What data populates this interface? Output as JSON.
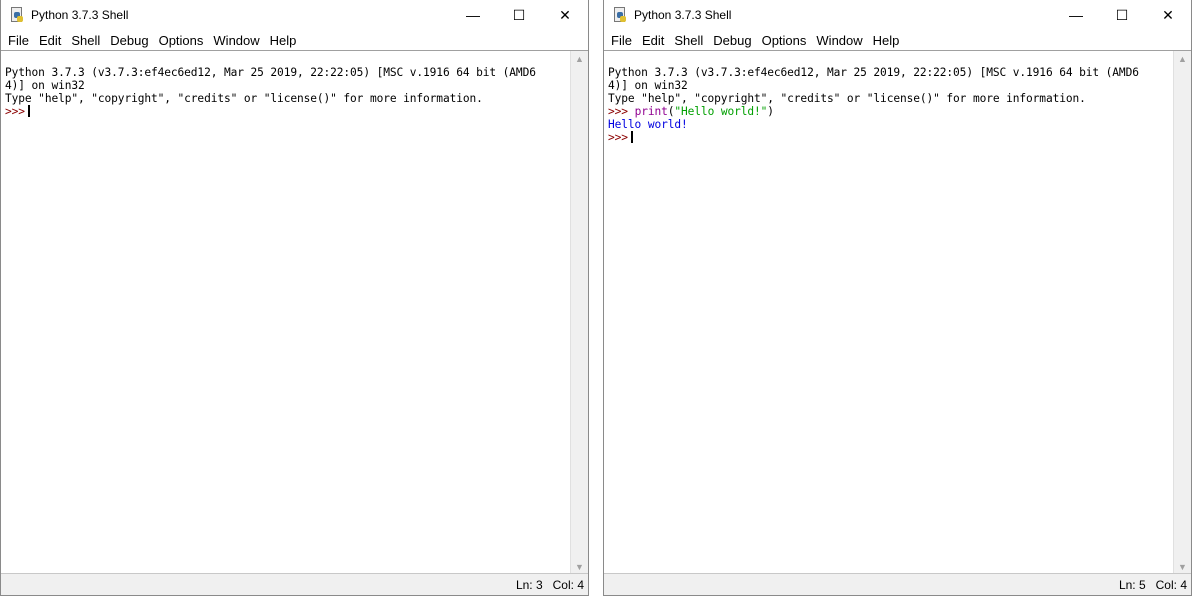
{
  "windows": [
    {
      "title": "Python 3.7.3 Shell",
      "menu": [
        "File",
        "Edit",
        "Shell",
        "Debug",
        "Options",
        "Window",
        "Help"
      ],
      "banner": [
        "Python 3.7.3 (v3.7.3:ef4ec6ed12, Mar 25 2019, 22:22:05) [MSC v.1916 64 bit (AMD6",
        "4)] on win32",
        "Type \"help\", \"copyright\", \"credits\" or \"license()\" for more information."
      ],
      "prompt": ">>>",
      "status": {
        "ln": "Ln: 3",
        "col": "Col: 4"
      }
    },
    {
      "title": "Python 3.7.3 Shell",
      "menu": [
        "File",
        "Edit",
        "Shell",
        "Debug",
        "Options",
        "Window",
        "Help"
      ],
      "banner": [
        "Python 3.7.3 (v3.7.3:ef4ec6ed12, Mar 25 2019, 22:22:05) [MSC v.1916 64 bit (AMD6",
        "4)] on win32",
        "Type \"help\", \"copyright\", \"credits\" or \"license()\" for more information."
      ],
      "prompt": ">>>",
      "input": {
        "keyword": "print",
        "open": "(",
        "string": "\"Hello world!\"",
        "close": ")"
      },
      "output": "Hello world!",
      "status": {
        "ln": "Ln: 5",
        "col": "Col: 4"
      }
    }
  ],
  "colors": {
    "prompt": "#8b0000",
    "keyword": "#900090",
    "string": "#00a000",
    "output": "#0000e0"
  },
  "icons": {
    "minimize": "—",
    "maximize": "☐",
    "close": "✕",
    "scroll_up": "▲",
    "scroll_down": "▼"
  }
}
